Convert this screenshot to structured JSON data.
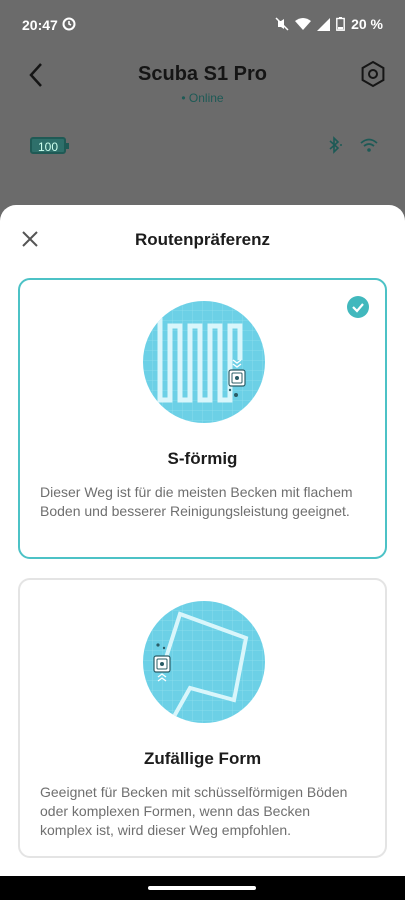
{
  "status_bar": {
    "time": "20:47",
    "battery": "20 %"
  },
  "header": {
    "title": "Scuba S1 Pro",
    "status": "• Online"
  },
  "device": {
    "battery_level": "100"
  },
  "sheet": {
    "title": "Routenpräferenz",
    "options": [
      {
        "title": "S-förmig",
        "description": "Dieser Weg ist für die meisten Becken mit flachem Boden und besserer Reinigungsleistung geeignet.",
        "selected": true
      },
      {
        "title": "Zufällige Form",
        "description": "Geeignet für Becken mit schüsselförmigen Böden oder komplexen Formen, wenn das Becken komplex ist, wird dieser Weg empfohlen.",
        "selected": false
      }
    ]
  },
  "colors": {
    "accent": "#41b8bd",
    "pool": "#6cd0e6",
    "dim_overlay": "#6b6b6b"
  }
}
